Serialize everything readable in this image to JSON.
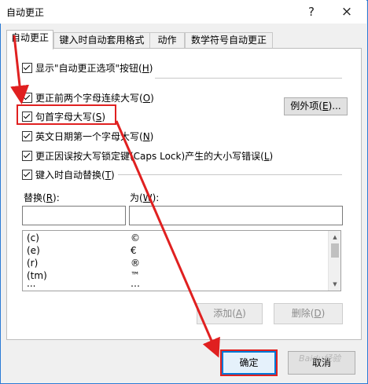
{
  "window": {
    "title": "自动更正",
    "help_glyph": "?",
    "close_glyph": "×"
  },
  "tabs": [
    {
      "label": "自动更正",
      "active": true
    },
    {
      "label": "键入时自动套用格式",
      "active": false
    },
    {
      "label": "动作",
      "active": false
    },
    {
      "label": "数学符号自动更正",
      "active": false
    }
  ],
  "options": {
    "show_buttons": {
      "label": "显示\"自动更正选项\"按钮(",
      "key": "H",
      "suffix": ")",
      "checked": true
    },
    "two_initial_caps": {
      "label": "更正前两个字母连续大写(",
      "key": "O",
      "suffix": ")",
      "checked": true
    },
    "capitalize_sentence": {
      "label": "句首字母大写(",
      "key": "S",
      "suffix": ")",
      "checked": true
    },
    "capitalize_days": {
      "label": "英文日期第一个字母大写(",
      "key": "N",
      "suffix": ")",
      "checked": true
    },
    "caps_lock": {
      "label": "更正因误按大写锁定键(Caps Lock)产生的大小写错误(",
      "key": "L",
      "suffix": ")",
      "checked": true
    },
    "replace_as_type": {
      "label": "键入时自动替换(",
      "key": "T",
      "suffix": ")",
      "checked": true
    }
  },
  "exceptions_button": {
    "label": "例外项(",
    "key": "E",
    "suffix": ")..."
  },
  "replace": {
    "label": "替换(",
    "key": "R",
    "suffix": "):",
    "value": ""
  },
  "with": {
    "label": "为(",
    "key": "W",
    "suffix": "):",
    "value": ""
  },
  "replacements": [
    {
      "from": "(c)",
      "to": "©"
    },
    {
      "from": "(e)",
      "to": "€"
    },
    {
      "from": "(r)",
      "to": "®"
    },
    {
      "from": "(tm)",
      "to": "™"
    },
    {
      "from": "...",
      "to": "…"
    }
  ],
  "add_button": {
    "label": "添加(",
    "key": "A",
    "suffix": ")",
    "enabled": false
  },
  "delete_button": {
    "label": "删除(",
    "key": "D",
    "suffix": ")",
    "enabled": false
  },
  "ok_button": {
    "label": "确定"
  },
  "cancel_button": {
    "label": "取消"
  },
  "annotation_color": "#e02020",
  "watermark": "Baidu经验"
}
